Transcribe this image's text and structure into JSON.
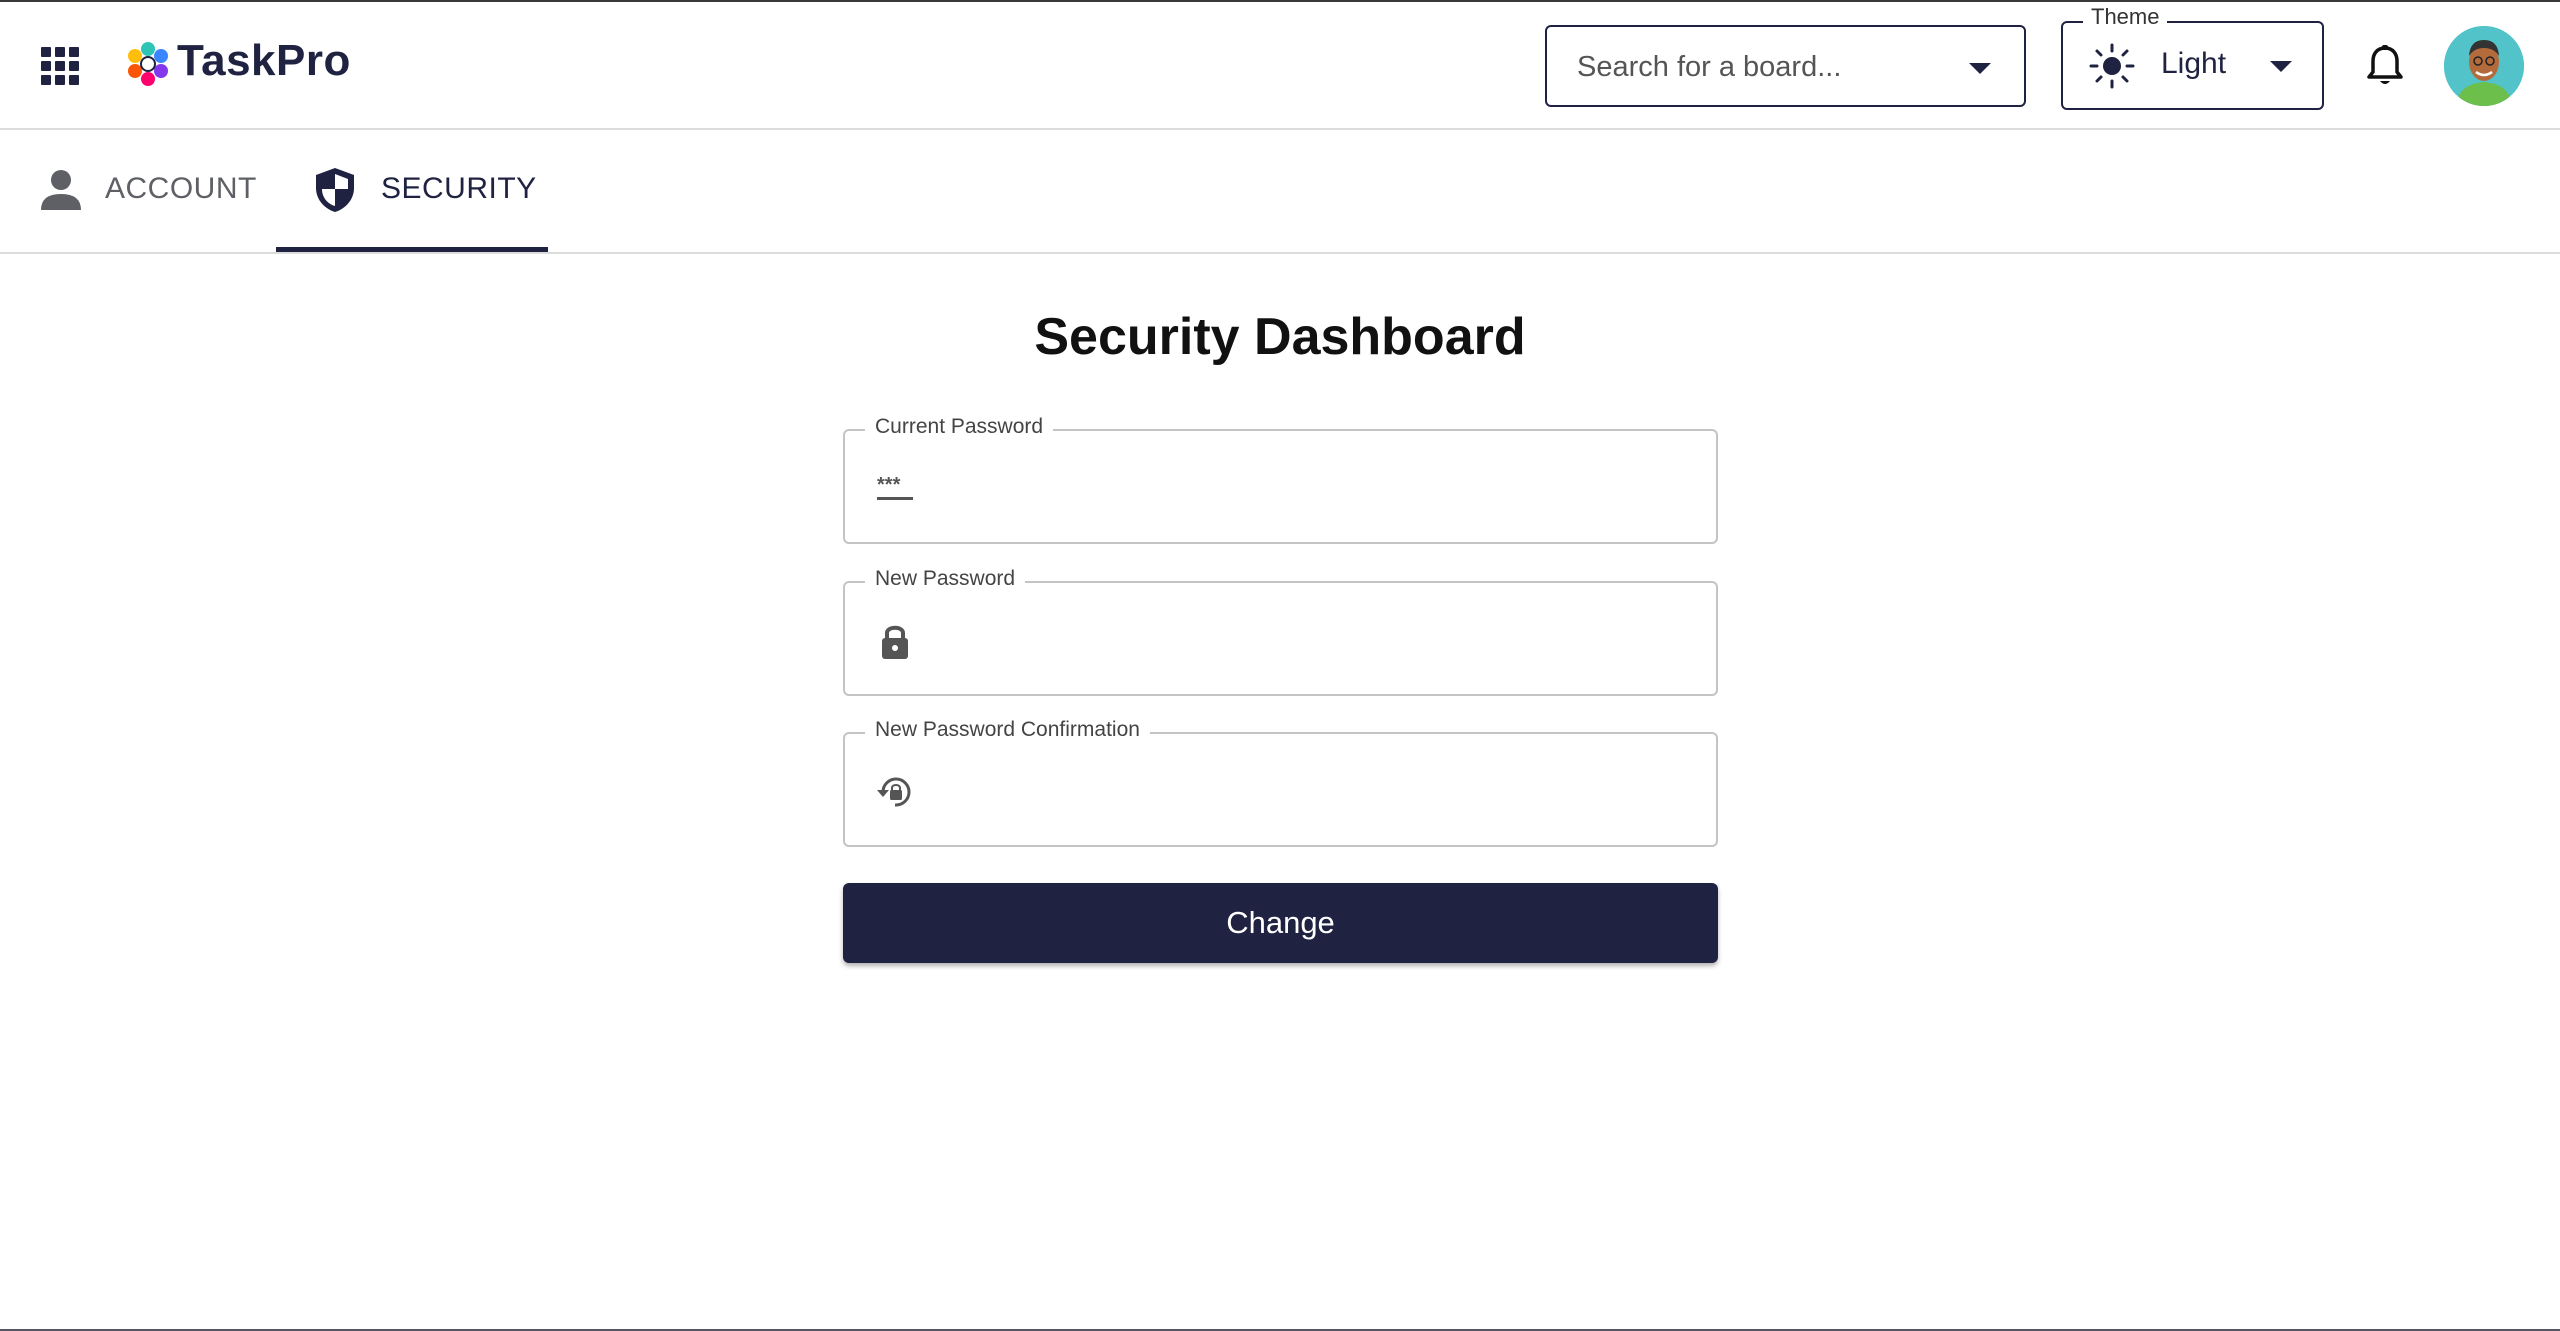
{
  "app": {
    "name": "TaskPro"
  },
  "header": {
    "search_placeholder": "Search for a board...",
    "theme_legend": "Theme",
    "theme_value": "Light"
  },
  "tabs": [
    {
      "label": "ACCOUNT",
      "icon": "person-icon",
      "active": false
    },
    {
      "label": "SECURITY",
      "icon": "shield-icon",
      "active": true
    }
  ],
  "main": {
    "title": "Security Dashboard",
    "fields": [
      {
        "label": "Current Password",
        "icon": "password-icon",
        "value": ""
      },
      {
        "label": "New Password",
        "icon": "lock-icon",
        "value": ""
      },
      {
        "label": "New Password Confirmation",
        "icon": "lock-reset-icon",
        "value": ""
      }
    ],
    "submit_label": "Change"
  },
  "colors": {
    "primary": "#1f2240",
    "border": "#c4c4c4",
    "avatar_bg": "#52c3c8"
  }
}
